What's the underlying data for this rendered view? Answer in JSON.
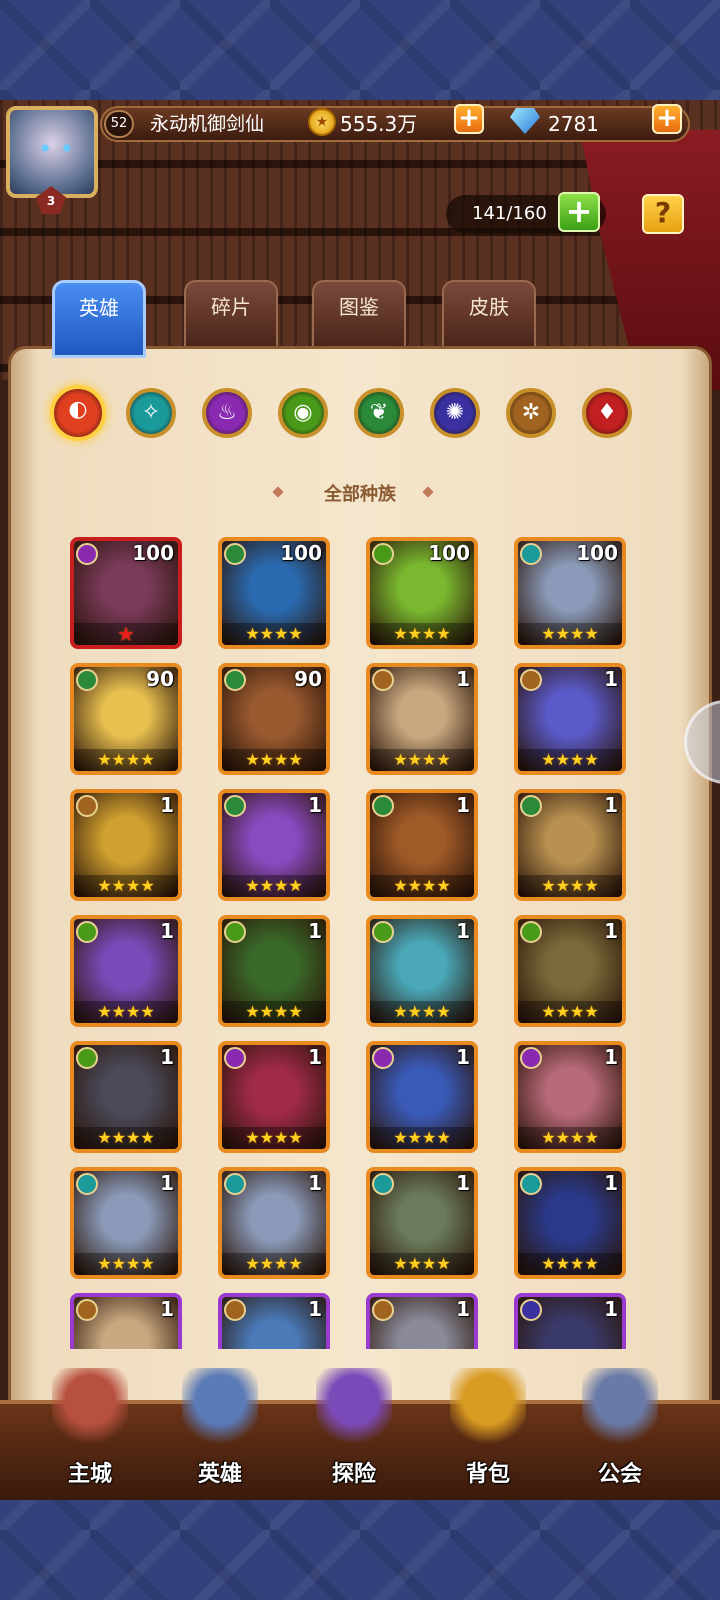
{
  "header": {
    "player_name": "永动机御剑仙",
    "player_level": "52",
    "vip_level": "3",
    "gold": "555.3万",
    "gold_symbol": "★",
    "gems": "2781",
    "plus_symbol": "+",
    "hero_slots": "141/160",
    "help_symbol": "?"
  },
  "tabs": [
    {
      "label": "英雄",
      "active": true
    },
    {
      "label": "碎片",
      "active": false
    },
    {
      "label": "图鉴",
      "active": false
    },
    {
      "label": "皮肤",
      "active": false
    }
  ],
  "race_filters": [
    {
      "name": "all-races",
      "glyph": "◐",
      "color": "#e04020",
      "active": true
    },
    {
      "name": "race-1",
      "glyph": "✧",
      "color": "#1a9a9a"
    },
    {
      "name": "race-2",
      "glyph": "♨",
      "color": "#8a2ab0"
    },
    {
      "name": "race-3",
      "glyph": "◉",
      "color": "#4a9a1a"
    },
    {
      "name": "race-4",
      "glyph": "❦",
      "color": "#2a8a3a"
    },
    {
      "name": "race-5",
      "glyph": "✺",
      "color": "#3a30a0"
    },
    {
      "name": "race-6",
      "glyph": "✲",
      "color": "#a06420"
    },
    {
      "name": "race-7",
      "glyph": "♦",
      "color": "#c02020"
    }
  ],
  "filter_label": "全部种族",
  "heroes": [
    {
      "level": "100",
      "stars": "★",
      "frame": "red",
      "race_color": "#8a2ab0",
      "bg": "#7a3a5a"
    },
    {
      "level": "100",
      "stars": "★★★★",
      "frame": "orange",
      "race_color": "#2a8a3a",
      "bg": "#2a6ab0"
    },
    {
      "level": "100",
      "stars": "★★★★",
      "frame": "orange",
      "race_color": "#4a9a1a",
      "bg": "#7ab830"
    },
    {
      "level": "100",
      "stars": "★★★★",
      "frame": "orange",
      "race_color": "#1a9a9a",
      "bg": "#8a9ab8"
    },
    {
      "level": "90",
      "stars": "★★★★",
      "frame": "orange",
      "race_color": "#2a8a3a",
      "bg": "#e8c050"
    },
    {
      "level": "90",
      "stars": "★★★★",
      "frame": "orange",
      "race_color": "#2a8a3a",
      "bg": "#9a5a30"
    },
    {
      "level": "1",
      "stars": "★★★★",
      "frame": "orange",
      "race_color": "#a06420",
      "bg": "#c8a880"
    },
    {
      "level": "1",
      "stars": "★★★★",
      "frame": "orange",
      "race_color": "#a06420",
      "bg": "#5a5ac8"
    },
    {
      "level": "1",
      "stars": "★★★★",
      "frame": "orange",
      "race_color": "#a06420",
      "bg": "#d0a030"
    },
    {
      "level": "1",
      "stars": "★★★★",
      "frame": "orange",
      "race_color": "#2a8a3a",
      "bg": "#8a4ac0"
    },
    {
      "level": "1",
      "stars": "★★★★",
      "frame": "orange",
      "race_color": "#2a8a3a",
      "bg": "#a05a28"
    },
    {
      "level": "1",
      "stars": "★★★★",
      "frame": "orange",
      "race_color": "#2a8a3a",
      "bg": "#b89050"
    },
    {
      "level": "1",
      "stars": "★★★★",
      "frame": "orange",
      "race_color": "#4a9a1a",
      "bg": "#7a4ab8"
    },
    {
      "level": "1",
      "stars": "★★★★",
      "frame": "orange",
      "race_color": "#4a9a1a",
      "bg": "#3a6a2a"
    },
    {
      "level": "1",
      "stars": "★★★★",
      "frame": "orange",
      "race_color": "#4a9a1a",
      "bg": "#4aa8b8"
    },
    {
      "level": "1",
      "stars": "★★★★",
      "frame": "orange",
      "race_color": "#4a9a1a",
      "bg": "#7a6a3a"
    },
    {
      "level": "1",
      "stars": "★★★★",
      "frame": "orange",
      "race_color": "#4a9a1a",
      "bg": "#4a4a5a"
    },
    {
      "level": "1",
      "stars": "★★★★",
      "frame": "orange",
      "race_color": "#8a2ab0",
      "bg": "#a02a4a"
    },
    {
      "level": "1",
      "stars": "★★★★",
      "frame": "orange",
      "race_color": "#8a2ab0",
      "bg": "#3a5ab8"
    },
    {
      "level": "1",
      "stars": "★★★★",
      "frame": "orange",
      "race_color": "#8a2ab0",
      "bg": "#b86a7a"
    },
    {
      "level": "1",
      "stars": "★★★★",
      "frame": "orange",
      "race_color": "#1a9a9a",
      "bg": "#8a9ab8"
    },
    {
      "level": "1",
      "stars": "★★★★",
      "frame": "orange",
      "race_color": "#1a9a9a",
      "bg": "#8a9ab8"
    },
    {
      "level": "1",
      "stars": "★★★★",
      "frame": "orange",
      "race_color": "#1a9a9a",
      "bg": "#6a7a5a"
    },
    {
      "level": "1",
      "stars": "★★★★",
      "frame": "orange",
      "race_color": "#1a9a9a",
      "bg": "#2a3a8a"
    },
    {
      "level": "1",
      "stars": "",
      "frame": "purple",
      "race_color": "#a06420",
      "bg": "#c8a880"
    },
    {
      "level": "1",
      "stars": "",
      "frame": "purple",
      "race_color": "#a06420",
      "bg": "#4a7ab8"
    },
    {
      "level": "1",
      "stars": "",
      "frame": "purple",
      "race_color": "#a06420",
      "bg": "#8a8a9a"
    },
    {
      "level": "1",
      "stars": "",
      "frame": "purple",
      "race_color": "#3a30a0",
      "bg": "#3a3a6a"
    }
  ],
  "nav": [
    {
      "label": "主城",
      "icon": "castle-icon",
      "color": "#b85040"
    },
    {
      "label": "英雄",
      "icon": "hero-icon",
      "color": "#5a7ab8"
    },
    {
      "label": "探险",
      "icon": "portal-icon",
      "color": "#7a4ab8"
    },
    {
      "label": "背包",
      "icon": "backpack-icon",
      "color": "#d89a20"
    },
    {
      "label": "公会",
      "icon": "guild-icon",
      "color": "#6a7aa8"
    }
  ]
}
